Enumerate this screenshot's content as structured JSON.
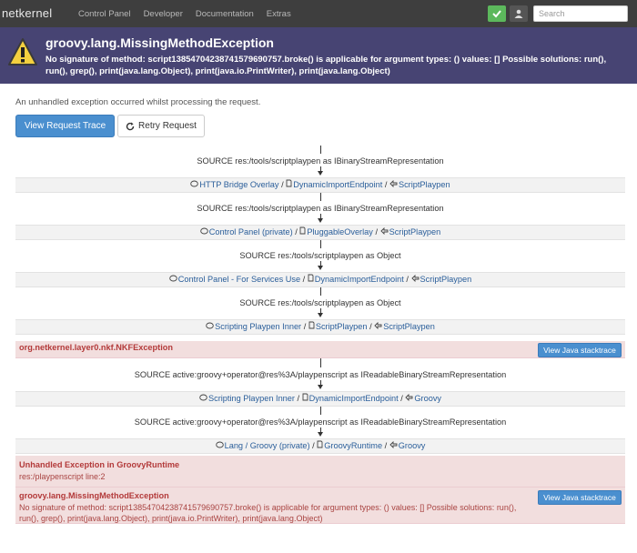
{
  "nav": {
    "brand": "netkernel",
    "links": [
      "Control Panel",
      "Developer",
      "Documentation",
      "Extras"
    ],
    "search_placeholder": "Search",
    "green_icon": "check-icon",
    "user_icon": "user-icon"
  },
  "banner": {
    "title": "groovy.lang.MissingMethodException",
    "message": "No signature of method: script13854704238741579690757.broke() is applicable for argument types: () values: [] Possible solutions: run(), run(), grep(), print(java.lang.Object), print(java.io.PrintWriter), print(java.lang.Object)",
    "icon": "warning-icon",
    "bg_color": "#474473"
  },
  "main": {
    "unhandled_text": "An unhandled exception occurred whilst processing the request.",
    "view_trace_label": "View Request Trace",
    "retry_label": "Retry Request"
  },
  "trace": {
    "sources": [
      "SOURCE res:/tools/scriptplaypen as IBinaryStreamRepresentation",
      "SOURCE res:/tools/scriptplaypen as IBinaryStreamRepresentation",
      "SOURCE res:/tools/scriptplaypen as Object",
      "SOURCE res:/tools/scriptplaypen as Object",
      "SOURCE active:groovy+operator@res%3A/playpenscript as IReadableBinaryStreamRepresentation",
      "SOURCE active:groovy+operator@res%3A/playpenscript as IReadableBinaryStreamRepresentation"
    ],
    "endpoints": [
      [
        "HTTP Bridge Overlay",
        "DynamicImportEndpoint",
        "ScriptPlaypen"
      ],
      [
        "Control Panel (private)",
        "PluggableOverlay",
        "ScriptPlaypen"
      ],
      [
        "Control Panel - For Services Use",
        "DynamicImportEndpoint",
        "ScriptPlaypen"
      ],
      [
        "Scripting Playpen Inner",
        "ScriptPlaypen",
        "ScriptPlaypen"
      ],
      [
        "Scripting Playpen Inner",
        "DynamicImportEndpoint",
        "Groovy"
      ],
      [
        "Lang / Groovy (private)",
        "GroovyRuntime",
        "Groovy"
      ]
    ],
    "separator": "/",
    "nkf_exception": "org.netkernel.layer0.nkf.NKFException",
    "stack_label": "View Java stacktrace",
    "unhandled_groovy_title": "Unhandled Exception in GroovyRuntime",
    "unhandled_groovy_sub": "res:/playpenscript line:2",
    "final_title": "groovy.lang.MissingMethodException",
    "final_message": "No signature of method: script13854704238741579690757.broke() is applicable for argument types: () values: [] Possible solutions: run(), run(), grep(), print(java.lang.Object), print(java.io.PrintWriter), print(java.lang.Object)"
  }
}
